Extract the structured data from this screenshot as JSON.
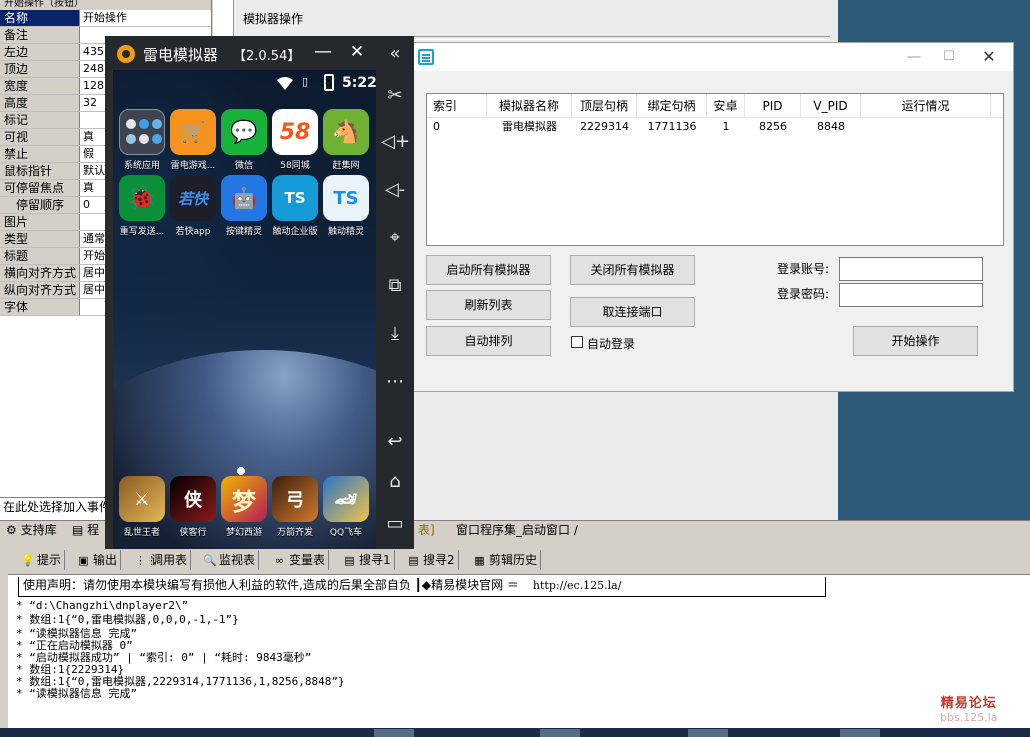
{
  "props": {
    "title": "开始操作（按钮）",
    "rows": [
      {
        "name": "名称",
        "value": "开始操作"
      },
      {
        "name": "备注",
        "value": ""
      },
      {
        "name": "左边",
        "value": "435"
      },
      {
        "name": "顶边",
        "value": "248"
      },
      {
        "name": "宽度",
        "value": "128"
      },
      {
        "name": "高度",
        "value": "32"
      },
      {
        "name": "标记",
        "value": ""
      },
      {
        "name": "可视",
        "value": "真"
      },
      {
        "name": "禁止",
        "value": "假"
      },
      {
        "name": "鼠标指针",
        "value": "默认"
      },
      {
        "name": "可停留焦点",
        "value": "真"
      },
      {
        "name": "停留顺序",
        "value": "0"
      },
      {
        "name": "图片",
        "value": ""
      },
      {
        "name": "类型",
        "value": "通常"
      },
      {
        "name": "标题",
        "value": "开始"
      },
      {
        "name": "横向对齐方式",
        "value": "居中"
      },
      {
        "name": "纵向对齐方式",
        "value": "居中"
      },
      {
        "name": "字体",
        "value": ""
      }
    ],
    "event_hint": "在此处选择加入事件"
  },
  "designer": {
    "label": "模拟器操作"
  },
  "lower_tabs": {
    "support": "支持库",
    "p2": "程",
    "bk": "表]",
    "window": "窗口程序集_启动窗口"
  },
  "tool_tabs": {
    "hint": "提示",
    "output": "输出",
    "calltable": "调用表",
    "watch": "监视表",
    "vartable": "变量表",
    "search1": "搜寻1",
    "search2": "搜寻2",
    "clip": "剪辑历史"
  },
  "output": {
    "notice": "使用声明：请勿使用本模块编写有损他人利益的软件,造成的后果全部自负  ┃◆精易模块官网  ＝",
    "url": "http://ec.125.la/",
    "lines": [
      "* “d:\\Changzhi\\dnplayer2\\”",
      "* 数组:1{“0,雷电模拟器,0,0,0,-1,-1”}",
      "* “读模拟器信息 完成”",
      "* “正在启动模拟器 0”",
      "* “启动模拟器成功” | “索引: 0” | “耗时: 9843毫秒”",
      "* 数组:1{2229314}",
      "* 数组:1{“0,雷电模拟器,2229314,1771136,1,8256,8848”}",
      "* “读模拟器信息 完成”"
    ]
  },
  "watermark": {
    "line1": "精易论坛",
    "line2": "bbs.125.la"
  },
  "emulator": {
    "name": "雷电模拟器",
    "version": "【2.0.54】",
    "clock": "5:22",
    "apps": [
      {
        "label": "系统应用",
        "glyph": ""
      },
      {
        "label": "雷电游戏...",
        "glyph": "🛒"
      },
      {
        "label": "微信",
        "glyph": "💬"
      },
      {
        "label": "58同城",
        "glyph": "58"
      },
      {
        "label": "赶集网",
        "glyph": "🐴"
      },
      {
        "label": "重写发送...",
        "glyph": "🐞"
      },
      {
        "label": "若快app",
        "glyph": "若快"
      },
      {
        "label": "按键精灵",
        "glyph": "🤖"
      },
      {
        "label": "触动企业版",
        "glyph": "TS"
      },
      {
        "label": "触动精灵",
        "glyph": "TS"
      }
    ],
    "dock": [
      {
        "label": "乱世王者",
        "glyph": "⚔"
      },
      {
        "label": "侠客行",
        "glyph": "侠"
      },
      {
        "label": "梦幻西游",
        "glyph": "梦"
      },
      {
        "label": "万箭齐发",
        "glyph": "弓"
      },
      {
        "label": "QQ飞车",
        "glyph": "🏎"
      }
    ]
  },
  "tool_window": {
    "columns": [
      "索引",
      "模拟器名称",
      "顶层句柄",
      "绑定句柄",
      "安卓",
      "PID",
      "V_PID",
      "运行情况"
    ],
    "rows": [
      [
        "0",
        "雷电模拟器",
        "2229314",
        "1771136",
        "1",
        "8256",
        "8848",
        ""
      ]
    ],
    "buttons": {
      "start_all": "启动所有模拟器",
      "close_all": "关闭所有模拟器",
      "refresh": "刷新列表",
      "disconnect": "取连接端口",
      "arrange": "自动排列",
      "go": "开始操作"
    },
    "auto_login": "自动登录",
    "account_label": "登录账号:",
    "password_label": "登录密码:",
    "account_value": "",
    "password_value": ""
  }
}
